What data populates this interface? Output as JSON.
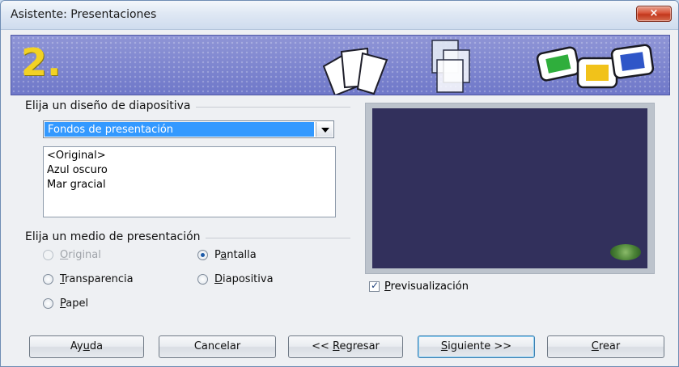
{
  "window": {
    "title": "Asistente: Presentaciones",
    "close_label": "×"
  },
  "banner": {
    "step": "2.",
    "icons": [
      "pages-stack-icon",
      "transparency-frames-icon",
      "colored-slides-icon"
    ]
  },
  "design_group": {
    "label": "Elija un diseño de diapositiva",
    "dropdown": {
      "selected": "Fondos de presentación"
    },
    "list": [
      "<Original>",
      "Azul oscuro",
      "Mar gracial"
    ]
  },
  "medium_group": {
    "label": "Elija un medio de presentación",
    "options": [
      {
        "pre": "",
        "key": "O",
        "post": "riginal",
        "state": "disabled"
      },
      {
        "pre": "P",
        "key": "a",
        "post": "ntalla",
        "state": "checked"
      },
      {
        "pre": "",
        "key": "T",
        "post": "ransparencia",
        "state": "unchecked"
      },
      {
        "pre": "",
        "key": "D",
        "post": "iapositiva",
        "state": "unchecked"
      },
      {
        "pre": "",
        "key": "P",
        "post": "apel",
        "state": "unchecked"
      }
    ]
  },
  "preview": {
    "checkbox": {
      "key": "P",
      "post": "revisualización",
      "checked": true
    },
    "background_color": "#32305c"
  },
  "buttons": {
    "help": {
      "pre": "Ay",
      "key": "u",
      "post": "da"
    },
    "cancel": {
      "label": "Cancelar"
    },
    "back": {
      "pre": "<< ",
      "key": "R",
      "post": "egresar"
    },
    "next": {
      "pre": "",
      "key": "S",
      "post": "iguiente >>"
    },
    "create": {
      "pre": "",
      "key": "C",
      "post": "rear"
    }
  }
}
